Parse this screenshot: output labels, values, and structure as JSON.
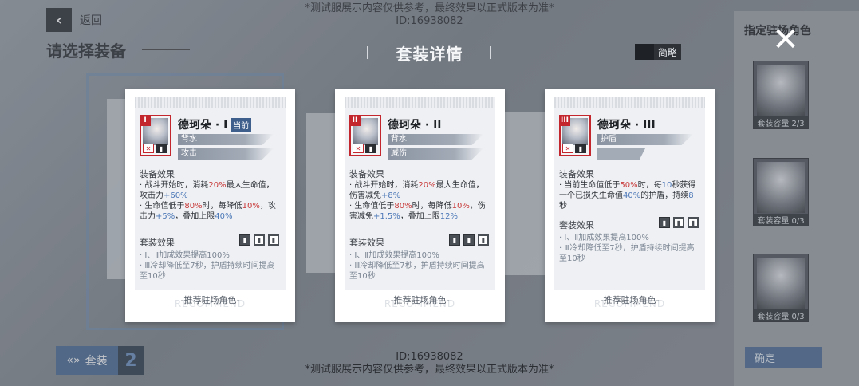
{
  "background": {
    "back_label": "返回",
    "select_title": "请选择装备",
    "right_panel": {
      "title": "指定驻场角色",
      "slots": [
        {
          "label": "套装容量 2/3"
        },
        {
          "label": "套装容量 0/3"
        },
        {
          "label": "套装容量 0/3"
        }
      ],
      "confirm_label": "确定"
    },
    "set_button_label": "套装",
    "set_count": "2"
  },
  "watermark": {
    "top_line1": "*测试服展示内容仅供参考，最终效果以正式版本为准*",
    "top_line2": "ID:16938082",
    "bottom_line1": "ID:16938082",
    "bottom_line2": "*测试服展示内容仅供参考，最终效果以正式版本为准*"
  },
  "modal": {
    "title": "套装详情",
    "toggle_label": "简略",
    "close_icon": "close-icon"
  },
  "cards": [
    {
      "rank": "I",
      "name": "德珂朵 · I",
      "current_tag": "当前",
      "tags": [
        "背水",
        "攻击"
      ],
      "equip_effect_title": "装备效果",
      "effects": [
        {
          "prefix": "· 战斗开始时，消耗",
          "v1": "20%",
          "mid": "最大生命值，攻击力",
          "v2": "+60%",
          "suffix": ""
        },
        {
          "prefix": "· 生命值低于",
          "v1": "80%",
          "mid": "时，每降低",
          "v2": "10%",
          "suffix": "，攻击力"
        },
        {
          "prefix": "",
          "v1": "",
          "mid": "",
          "v2": "+5%",
          "suffix": "，叠加上限"
        },
        {
          "prefix": "",
          "v1": "",
          "mid": "",
          "v2": "40%",
          "suffix": ""
        }
      ],
      "set_effect_title": "套装效果",
      "set_lines": [
        "· Ⅰ、Ⅱ加成效果提高100%",
        "· Ⅲ冷却降低至7秒，护盾持续时间提高至10秒"
      ],
      "recommend": "-推荐驻场角色-",
      "recommend_ghost": "RECOMMEND"
    },
    {
      "rank": "II",
      "name": "德珂朵 · II",
      "current_tag": "",
      "tags": [
        "背水",
        "减伤"
      ],
      "equip_effect_title": "装备效果",
      "effects": [
        {
          "prefix": "· 战斗开始时，消耗",
          "v1": "20%",
          "mid": "最大生命值，伤害减免",
          "v2": "+8%",
          "suffix": ""
        },
        {
          "prefix": "· 生命值低于",
          "v1": "80%",
          "mid": "时，每降低",
          "v2": "10%",
          "suffix": "，伤害减免"
        },
        {
          "prefix": "",
          "v1": "",
          "mid": "",
          "v2": "+1.5%",
          "suffix": "，叠加上限"
        },
        {
          "prefix": "",
          "v1": "",
          "mid": "",
          "v2": "12%",
          "suffix": ""
        }
      ],
      "set_effect_title": "套装效果",
      "set_lines": [
        "· Ⅰ、Ⅱ加成效果提高100%",
        "· Ⅲ冷却降低至7秒，护盾持续时间提高至10秒"
      ],
      "recommend": "-推荐驻场角色-",
      "recommend_ghost": "RECOMMEND"
    },
    {
      "rank": "III",
      "name": "德珂朵 · III",
      "current_tag": "",
      "tags": [
        "护盾",
        ""
      ],
      "equip_effect_title": "装备效果",
      "effects": [
        {
          "prefix": "· 当前生命值低于",
          "v1": "50%",
          "mid": "时，每",
          "v2": "10",
          "suffix": "秒获得一个已损失生命值"
        },
        {
          "prefix": "",
          "v1": "",
          "mid": "",
          "v2": "40%",
          "suffix": "的护盾，持续"
        },
        {
          "prefix": "",
          "v1": "",
          "mid": "",
          "v2": "8",
          "suffix": "秒"
        }
      ],
      "set_effect_title": "套装效果",
      "set_lines": [
        "· Ⅰ、Ⅱ加成效果提高100%",
        "· Ⅲ冷却降低至7秒，护盾持续时间提高至10秒"
      ],
      "recommend": "-推荐驻场角色-",
      "recommend_ghost": "RECOMMEND"
    }
  ]
}
